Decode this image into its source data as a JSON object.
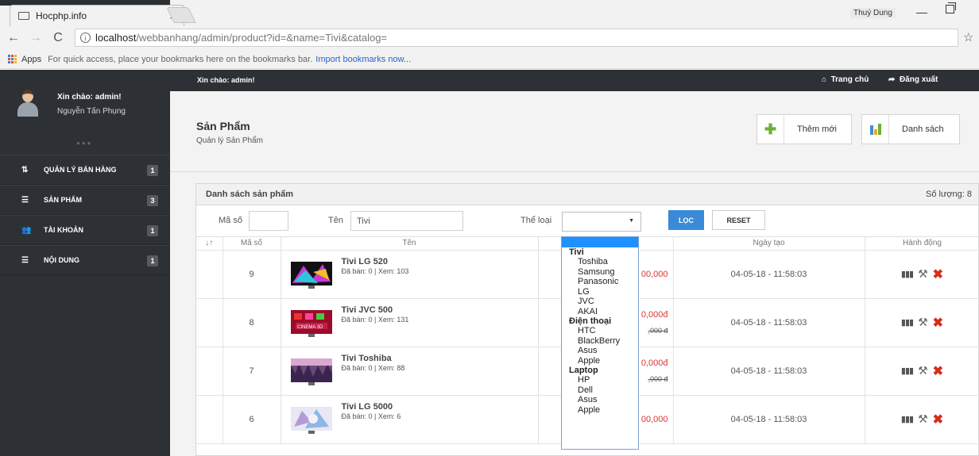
{
  "browser": {
    "tab_title": "Hocphp.info",
    "tab_close": "×",
    "profile_name": "Thuý Dung",
    "url_host": "localhost",
    "url_path": "/webbanhang/admin/product?id=&name=Tivi&catalog=",
    "bookmarks": {
      "apps": "Apps",
      "hint": "For quick access, place your bookmarks here on the bookmarks bar.",
      "import_link": "Import bookmarks now..."
    }
  },
  "sidebar": {
    "greeting": "Xin chào: admin!",
    "user_name": "Nguyễn Tấn Phụng",
    "items": [
      {
        "label": "QUẢN LÝ BÁN HÀNG",
        "badge": "1",
        "icon": "⇅"
      },
      {
        "label": "SẢN PHẨM",
        "badge": "3",
        "icon": "☰"
      },
      {
        "label": "TÀI KHOẢN",
        "badge": "1",
        "icon": "👥"
      },
      {
        "label": "NỘI DUNG",
        "badge": "1",
        "icon": "☰"
      }
    ]
  },
  "topbar": {
    "greeting": "Xin chào: admin!",
    "home": "Trang chủ",
    "logout": "Đăng xuất"
  },
  "page": {
    "title": "Sản Phẩm",
    "subtitle": "Quản lý Sản Phẩm",
    "add_button": "Thêm mới",
    "list_button": "Danh sách"
  },
  "panel": {
    "title": "Danh sách sản phẩm",
    "count": "Số lượng: 8"
  },
  "filter": {
    "id_label": "Mã số",
    "id_value": "",
    "name_label": "Tên",
    "name_value": "Tivi",
    "catalog_label": "Thể loại",
    "filter_button": "LỌC",
    "reset_button": "RESET"
  },
  "table": {
    "headers": [
      "↓↑",
      "Mã số",
      "Tên",
      "",
      "Ngày tạo",
      "Hành động"
    ],
    "rows": [
      {
        "id": "9",
        "name": "Tivi LG 520",
        "meta": "Đã bán: 0 | Xem: 103",
        "price": "00,000",
        "price_old": "",
        "date": "04-05-18 - 11:58:03"
      },
      {
        "id": "8",
        "name": "Tivi JVC 500",
        "meta": "Đã bán: 0 | Xem: 131",
        "price": "0,000đ",
        "price_old": ",000 đ",
        "date": "04-05-18 - 11:58:03"
      },
      {
        "id": "7",
        "name": "Tivi Toshiba",
        "meta": "Đã bán: 0 | Xem: 88",
        "price": "0,000đ",
        "price_old": ",000 đ",
        "date": "04-05-18 - 11:58:03"
      },
      {
        "id": "6",
        "name": "Tivi LG 5000",
        "meta": "Đã bán: 0 | Xem: 6",
        "price": "00,000",
        "price_old": "",
        "date": "04-05-18 - 11:58:03"
      }
    ]
  },
  "dropdown": {
    "groups": [
      {
        "label": "Tivi",
        "options": [
          "Toshiba",
          "Samsung",
          "Panasonic",
          "LG",
          "JVC",
          "AKAI"
        ]
      },
      {
        "label": "Điện thoại",
        "options": [
          "HTC",
          "BlackBerry",
          "Asus",
          "Apple"
        ]
      },
      {
        "label": "Laptop",
        "options": [
          "HP",
          "Dell",
          "Asus",
          "Apple"
        ]
      }
    ]
  },
  "colors": {
    "sidebar_bg": "#2d3136",
    "accent_blue": "#3a8ad8",
    "price_red": "#dd3333",
    "delete_red": "#d62e1b"
  }
}
